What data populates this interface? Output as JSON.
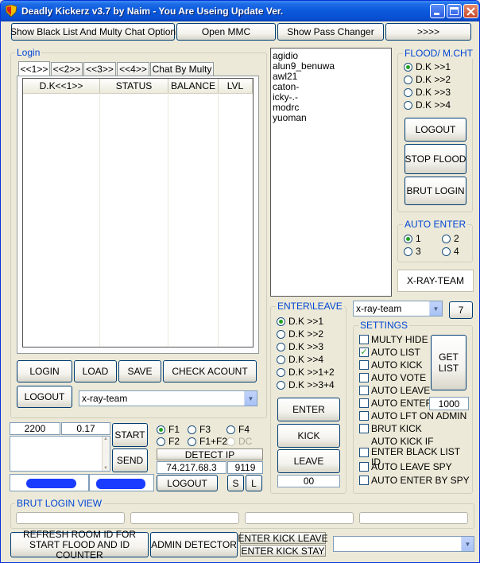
{
  "window": {
    "title": "Deadly Kickerz v3.7 by Naim - You Are Useing Update Ver."
  },
  "top_buttons": {
    "blacklist": "Show Black List And Multy Chat Option",
    "mmc": "Open MMC",
    "pass_changer": "Show Pass Changer",
    "more": ">>>>"
  },
  "login": {
    "group_title": "Login",
    "tabs": [
      "<<1>>",
      "<<2>>",
      "<<3>>",
      "<<4>>",
      "Chat By Multy"
    ],
    "columns": [
      "D.K<<1>>",
      "STATUS",
      "BALANCE",
      "LVL"
    ],
    "buttons": {
      "login": "LOGIN",
      "load": "LOAD",
      "save": "SAVE",
      "check_account": "CHECK ACOUNT",
      "logout": "LOGOUT"
    },
    "room_select": "x-ray-team"
  },
  "user_list": [
    "agidio",
    "alun9_benuwa",
    "awl21",
    "caton-",
    "icky-.-",
    "modrc",
    "yuoman"
  ],
  "flood": {
    "title": "FLOOD/ M.CHT",
    "options": [
      {
        "label": "D.K >>1",
        "selected": true
      },
      {
        "label": "D.K >>2",
        "selected": false
      },
      {
        "label": "D.K >>3",
        "selected": false
      },
      {
        "label": "D.K >>4",
        "selected": false
      }
    ],
    "buttons": {
      "logout": "LOGOUT",
      "stop_flood": "STOP FLOOD",
      "brut_login": "BRUT LOGIN"
    }
  },
  "auto_enter": {
    "title": "AUTO ENTER",
    "options": [
      {
        "label": "1",
        "selected": true
      },
      {
        "label": "2",
        "selected": false
      },
      {
        "label": "3",
        "selected": false
      },
      {
        "label": "4",
        "selected": false
      }
    ],
    "team_label": "X-RAY-TEAM"
  },
  "enter_leave": {
    "title": "ENTER\\LEAVE",
    "options": [
      {
        "label": "D.K >>1",
        "selected": true
      },
      {
        "label": "D.K >>2",
        "selected": false
      },
      {
        "label": "D.K >>3",
        "selected": false
      },
      {
        "label": "D.K >>4",
        "selected": false
      },
      {
        "label": "D.K >>1+2",
        "selected": false
      },
      {
        "label": "D.K >>3+4",
        "selected": false
      }
    ],
    "buttons": {
      "enter": "ENTER",
      "kick": "KICK",
      "leave": "LEAVE"
    },
    "counter": "00"
  },
  "room_combo": {
    "value": "x-ray-team",
    "count_button": "7"
  },
  "settings": {
    "title": "SETTINGS",
    "items": [
      {
        "label": "MULTY HIDE",
        "checked": false
      },
      {
        "label": "AUTO LIST",
        "checked": true
      },
      {
        "label": "AUTO KICK",
        "checked": false
      },
      {
        "label": "AUTO VOTE",
        "checked": false
      },
      {
        "label": "AUTO LEAVE",
        "checked": false
      },
      {
        "label": "AUTO ENTER",
        "checked": false
      },
      {
        "label": "AUTO LFT ON ADMIN",
        "checked": false
      },
      {
        "label": "BRUT KICK",
        "checked": false
      },
      {
        "label": "AUTO KICK IF ENTER BLACK LIST ID",
        "checked": false
      },
      {
        "label": "AUTO LEAVE SPY",
        "checked": false
      },
      {
        "label": "AUTO ENTER BY SPY",
        "checked": false
      }
    ],
    "auto_enter_value": "1000",
    "get_list": "GET LIST"
  },
  "flood_panel": {
    "count": "2200",
    "delay": "0.17",
    "start": "START",
    "send": "SEND",
    "f_options": [
      {
        "label": "F1",
        "selected": true,
        "disabled": false
      },
      {
        "label": "F3",
        "selected": false,
        "disabled": false
      },
      {
        "label": "F4",
        "selected": false,
        "disabled": false
      },
      {
        "label": "F2",
        "selected": false,
        "disabled": false
      },
      {
        "label": "F1+F2",
        "selected": false,
        "disabled": false
      },
      {
        "label": "DC",
        "selected": false,
        "disabled": true
      }
    ],
    "detect_ip": "DETECT IP",
    "ip": "74.217.68.3",
    "port": "9119",
    "logout": "LOGOUT",
    "s_button": "S",
    "l_button": "L"
  },
  "brut_login_view": {
    "title": "BRUT LOGIN VIEW"
  },
  "bottom": {
    "refresh_room": "REFRESH ROOM ID FOR START FLOOD AND ID COUNTER",
    "admin_detector": "ADMIN DETECTOR",
    "enter_kick_leave": "ENTER KICK LEAVE",
    "enter_kick_stay": "ENTER KICK STAY",
    "combo_value": ""
  },
  "colors": {
    "title_bar": "#0a58dc",
    "group_title": "#0046d5",
    "redacted": "#1a3cff",
    "check_mark": "#21a121"
  }
}
